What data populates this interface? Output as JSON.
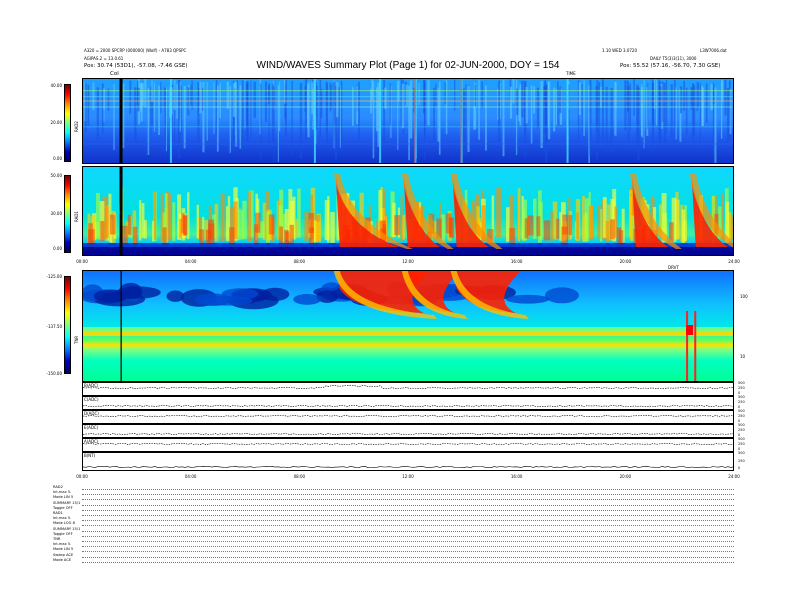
{
  "header": {
    "title": "WIND/WAVES Summary Plot (Page 1) for 02-JUN-2000, DOY = 154",
    "top_left_line1": "A320 = 2000 SPCRP (000000) (Wolf) - A783 QPSPC",
    "top_left_line2": "AGIPAS.2 = 13.0.61",
    "top_left_pos": "Pos:  30.74 (53D1), -57.08, -7.46 GSE)",
    "top_center": "TIME",
    "top_right_line1": "1.10 WED 3.0720",
    "top_right_line2": "L3W7006.dat",
    "top_right_line3": "DAILY  T5(3)3(11), 3000",
    "top_right_pos": "Pos:  55.52 (57.16, -56.70, 7.30 GSE)"
  },
  "chart_data": [
    {
      "type": "heatmap",
      "name": "RAD2",
      "ylabel": "RAD2",
      "y_ticks": [
        "40.00",
        "20.00",
        "0.00"
      ],
      "ylim": [
        0,
        40
      ],
      "x_range_hours": [
        0,
        24
      ],
      "cursor_label": "Col",
      "cursor_hour": 1.4
    },
    {
      "type": "heatmap",
      "name": "RAD1",
      "ylabel": "RAD1",
      "y_ticks": [
        "50.00",
        "30.00",
        "0.00"
      ],
      "ylim": [
        0,
        50
      ],
      "x_range_hours": [
        0,
        24
      ],
      "x_ticks": [
        "00:00",
        "04:00",
        "08:00",
        "12:00",
        "16:00",
        "20:00",
        "24:00"
      ],
      "bursts_hours": [
        9.6,
        12.1,
        13.9,
        20.5,
        22.7
      ]
    },
    {
      "type": "heatmap",
      "name": "TNR",
      "ylabel": "TNR",
      "y_ticks": [
        "-125.00",
        "-137.50",
        "-150.00"
      ],
      "ylim": [
        -150,
        -125
      ],
      "right_ticks": [
        "100",
        "10"
      ],
      "top_right_label": "DRVT"
    },
    {
      "type": "line",
      "series_labels": [
        "B(ADC)",
        "C(ADC)",
        "D(ADC)",
        "E(ADC)",
        "A(ADC)",
        "B(NT)"
      ],
      "right_scale_labels": [
        "500",
        "250",
        "0"
      ],
      "x_ticks": [
        "00:00",
        "04:00",
        "08:00",
        "12:00",
        "16:00",
        "20:00",
        "24:00"
      ]
    }
  ],
  "footer": {
    "lines": [
      "RAD2",
      "Int.max    5.",
      "Mode   LIN  5",
      "SUMMARY  15/1",
      "Toggle    OFF",
      "RAD1",
      "Int.max    5.",
      "Mode   LOG  8",
      "SUMMARY  15/1",
      "Toggle    OFF",
      "TNR",
      "Int.max   5.",
      "Mode   LIN  5",
      "Sweep    ACE",
      "Mode      ACE"
    ]
  },
  "colors": {
    "low": "#0000c0",
    "mid": "#00ffff",
    "high": "#ff0000"
  }
}
